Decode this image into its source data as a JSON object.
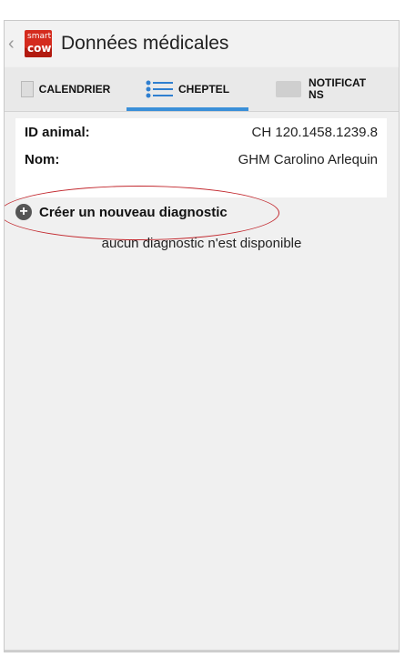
{
  "header": {
    "back_glyph": "‹",
    "logo_line1": "smart",
    "logo_line2": "cow",
    "title": "Données médicales"
  },
  "tabs": [
    {
      "label": "CALENDRIER",
      "icon": "calendar-icon"
    },
    {
      "label": "CHEPTEL",
      "icon": "list-icon",
      "active": true
    },
    {
      "label": "NOTIFICATIONS",
      "label_line1": "NOTIFICAT",
      "label_line2": "NS",
      "icon": "message-icon"
    }
  ],
  "animal": {
    "id_label": "ID animal:",
    "id_value": "CH 120.1458.1239.8",
    "name_label": "Nom:",
    "name_value": "GHM Carolino Arlequin"
  },
  "actions": {
    "create_label": "Créer un nouveau diagnostic",
    "create_icon": "plus-circle-icon"
  },
  "empty_message": "aucun diagnostic n'est disponible",
  "colors": {
    "accent": "#3a8fd8",
    "logo": "#d42b1e",
    "highlight": "#c2282e"
  }
}
